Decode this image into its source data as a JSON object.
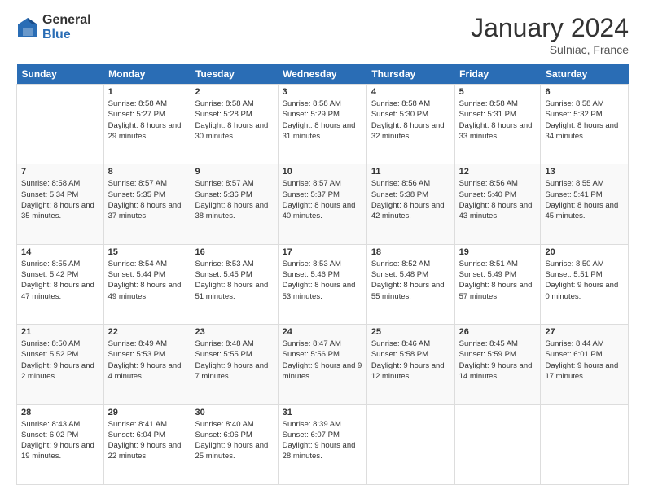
{
  "header": {
    "logo_general": "General",
    "logo_blue": "Blue",
    "month_title": "January 2024",
    "location": "Sulniac, France"
  },
  "weekdays": [
    "Sunday",
    "Monday",
    "Tuesday",
    "Wednesday",
    "Thursday",
    "Friday",
    "Saturday"
  ],
  "weeks": [
    [
      {
        "day": "",
        "info": ""
      },
      {
        "day": "1",
        "info": "Sunrise: 8:58 AM\nSunset: 5:27 PM\nDaylight: 8 hours\nand 29 minutes."
      },
      {
        "day": "2",
        "info": "Sunrise: 8:58 AM\nSunset: 5:28 PM\nDaylight: 8 hours\nand 30 minutes."
      },
      {
        "day": "3",
        "info": "Sunrise: 8:58 AM\nSunset: 5:29 PM\nDaylight: 8 hours\nand 31 minutes."
      },
      {
        "day": "4",
        "info": "Sunrise: 8:58 AM\nSunset: 5:30 PM\nDaylight: 8 hours\nand 32 minutes."
      },
      {
        "day": "5",
        "info": "Sunrise: 8:58 AM\nSunset: 5:31 PM\nDaylight: 8 hours\nand 33 minutes."
      },
      {
        "day": "6",
        "info": "Sunrise: 8:58 AM\nSunset: 5:32 PM\nDaylight: 8 hours\nand 34 minutes."
      }
    ],
    [
      {
        "day": "7",
        "info": "Sunrise: 8:58 AM\nSunset: 5:34 PM\nDaylight: 8 hours\nand 35 minutes."
      },
      {
        "day": "8",
        "info": "Sunrise: 8:57 AM\nSunset: 5:35 PM\nDaylight: 8 hours\nand 37 minutes."
      },
      {
        "day": "9",
        "info": "Sunrise: 8:57 AM\nSunset: 5:36 PM\nDaylight: 8 hours\nand 38 minutes."
      },
      {
        "day": "10",
        "info": "Sunrise: 8:57 AM\nSunset: 5:37 PM\nDaylight: 8 hours\nand 40 minutes."
      },
      {
        "day": "11",
        "info": "Sunrise: 8:56 AM\nSunset: 5:38 PM\nDaylight: 8 hours\nand 42 minutes."
      },
      {
        "day": "12",
        "info": "Sunrise: 8:56 AM\nSunset: 5:40 PM\nDaylight: 8 hours\nand 43 minutes."
      },
      {
        "day": "13",
        "info": "Sunrise: 8:55 AM\nSunset: 5:41 PM\nDaylight: 8 hours\nand 45 minutes."
      }
    ],
    [
      {
        "day": "14",
        "info": "Sunrise: 8:55 AM\nSunset: 5:42 PM\nDaylight: 8 hours\nand 47 minutes."
      },
      {
        "day": "15",
        "info": "Sunrise: 8:54 AM\nSunset: 5:44 PM\nDaylight: 8 hours\nand 49 minutes."
      },
      {
        "day": "16",
        "info": "Sunrise: 8:53 AM\nSunset: 5:45 PM\nDaylight: 8 hours\nand 51 minutes."
      },
      {
        "day": "17",
        "info": "Sunrise: 8:53 AM\nSunset: 5:46 PM\nDaylight: 8 hours\nand 53 minutes."
      },
      {
        "day": "18",
        "info": "Sunrise: 8:52 AM\nSunset: 5:48 PM\nDaylight: 8 hours\nand 55 minutes."
      },
      {
        "day": "19",
        "info": "Sunrise: 8:51 AM\nSunset: 5:49 PM\nDaylight: 8 hours\nand 57 minutes."
      },
      {
        "day": "20",
        "info": "Sunrise: 8:50 AM\nSunset: 5:51 PM\nDaylight: 9 hours\nand 0 minutes."
      }
    ],
    [
      {
        "day": "21",
        "info": "Sunrise: 8:50 AM\nSunset: 5:52 PM\nDaylight: 9 hours\nand 2 minutes."
      },
      {
        "day": "22",
        "info": "Sunrise: 8:49 AM\nSunset: 5:53 PM\nDaylight: 9 hours\nand 4 minutes."
      },
      {
        "day": "23",
        "info": "Sunrise: 8:48 AM\nSunset: 5:55 PM\nDaylight: 9 hours\nand 7 minutes."
      },
      {
        "day": "24",
        "info": "Sunrise: 8:47 AM\nSunset: 5:56 PM\nDaylight: 9 hours\nand 9 minutes."
      },
      {
        "day": "25",
        "info": "Sunrise: 8:46 AM\nSunset: 5:58 PM\nDaylight: 9 hours\nand 12 minutes."
      },
      {
        "day": "26",
        "info": "Sunrise: 8:45 AM\nSunset: 5:59 PM\nDaylight: 9 hours\nand 14 minutes."
      },
      {
        "day": "27",
        "info": "Sunrise: 8:44 AM\nSunset: 6:01 PM\nDaylight: 9 hours\nand 17 minutes."
      }
    ],
    [
      {
        "day": "28",
        "info": "Sunrise: 8:43 AM\nSunset: 6:02 PM\nDaylight: 9 hours\nand 19 minutes."
      },
      {
        "day": "29",
        "info": "Sunrise: 8:41 AM\nSunset: 6:04 PM\nDaylight: 9 hours\nand 22 minutes."
      },
      {
        "day": "30",
        "info": "Sunrise: 8:40 AM\nSunset: 6:06 PM\nDaylight: 9 hours\nand 25 minutes."
      },
      {
        "day": "31",
        "info": "Sunrise: 8:39 AM\nSunset: 6:07 PM\nDaylight: 9 hours\nand 28 minutes."
      },
      {
        "day": "",
        "info": ""
      },
      {
        "day": "",
        "info": ""
      },
      {
        "day": "",
        "info": ""
      }
    ]
  ]
}
